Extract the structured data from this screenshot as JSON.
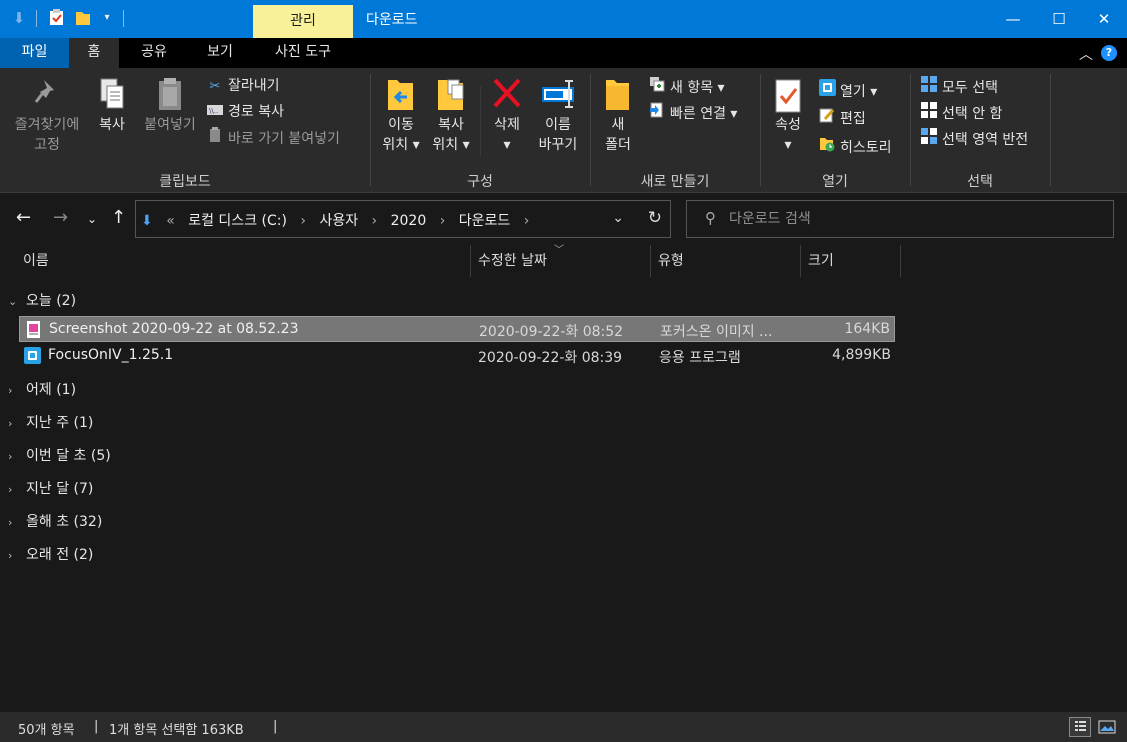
{
  "titlebar": {
    "manage_tab": "관리",
    "title": "다운로드",
    "minimize": "—",
    "maximize": "☐",
    "close": "✕"
  },
  "tabs": {
    "file": "파일",
    "home": "홈",
    "share": "공유",
    "view": "보기",
    "photo_tools": "사진 도구"
  },
  "ribbon": {
    "clipboard": {
      "label": "클립보드",
      "pin_line1": "즐겨찾기에",
      "pin_line2": "고정",
      "copy": "복사",
      "paste": "붙여넣기",
      "cut": "잘라내기",
      "copy_path": "경로 복사",
      "paste_shortcut": "바로 가기 붙여넣기"
    },
    "organize": {
      "label": "구성",
      "move_line1": "이동",
      "move_line2": "위치 ▾",
      "copyto_line1": "복사",
      "copyto_line2": "위치 ▾",
      "delete_line1": "삭제",
      "delete_line2": "▾",
      "rename_line1": "이름",
      "rename_line2": "바꾸기"
    },
    "new": {
      "label": "새로 만들기",
      "folder_line1": "새",
      "folder_line2": "폴더",
      "new_item": "새 항목 ▾",
      "easy_access": "빠른 연결 ▾"
    },
    "open": {
      "label": "열기",
      "properties_line1": "속성",
      "properties_line2": "▾",
      "open": "열기 ▾",
      "edit": "편집",
      "history": "히스토리"
    },
    "select": {
      "label": "선택",
      "select_all": "모두 선택",
      "select_none": "선택 안 함",
      "invert": "선택 영역 반전"
    }
  },
  "address": {
    "crumbs": [
      "«",
      "로컬 디스크 (C:)",
      "›",
      "사용자",
      "›",
      "2020",
      "›",
      "다운로드",
      "›"
    ],
    "search_placeholder": "다운로드 검색"
  },
  "columns": {
    "name": "이름",
    "date": "수정한 날짜",
    "type": "유형",
    "size": "크기"
  },
  "groups": [
    {
      "label": "오늘 (2)",
      "expanded": true
    },
    {
      "label": "어제 (1)",
      "expanded": false
    },
    {
      "label": "지난 주 (1)",
      "expanded": false
    },
    {
      "label": "이번 달 초 (5)",
      "expanded": false
    },
    {
      "label": "지난 달 (7)",
      "expanded": false
    },
    {
      "label": "올해 초 (32)",
      "expanded": false
    },
    {
      "label": "오래 전 (2)",
      "expanded": false
    }
  ],
  "files": [
    {
      "name": "Screenshot 2020-09-22 at 08.52.23",
      "date": "2020-09-22-화 08:52",
      "type": "포커스온 이미지 ...",
      "size": "164KB",
      "selected": true,
      "icon": "image-file-icon"
    },
    {
      "name": "FocusOnIV_1.25.1",
      "date": "2020-09-22-화 08:39",
      "type": "응용 프로그램",
      "size": "4,899KB",
      "selected": false,
      "icon": "application-icon"
    }
  ],
  "status": {
    "count": "50개 항목",
    "sep1": "|",
    "selection": "1개 항목 선택함 163KB",
    "sep2": "|"
  },
  "colors": {
    "accent": "#0078d7",
    "manage_tab": "#f8f19a",
    "background": "#191919",
    "ribbon": "#2b2b2b",
    "selected_row": "#777777"
  }
}
